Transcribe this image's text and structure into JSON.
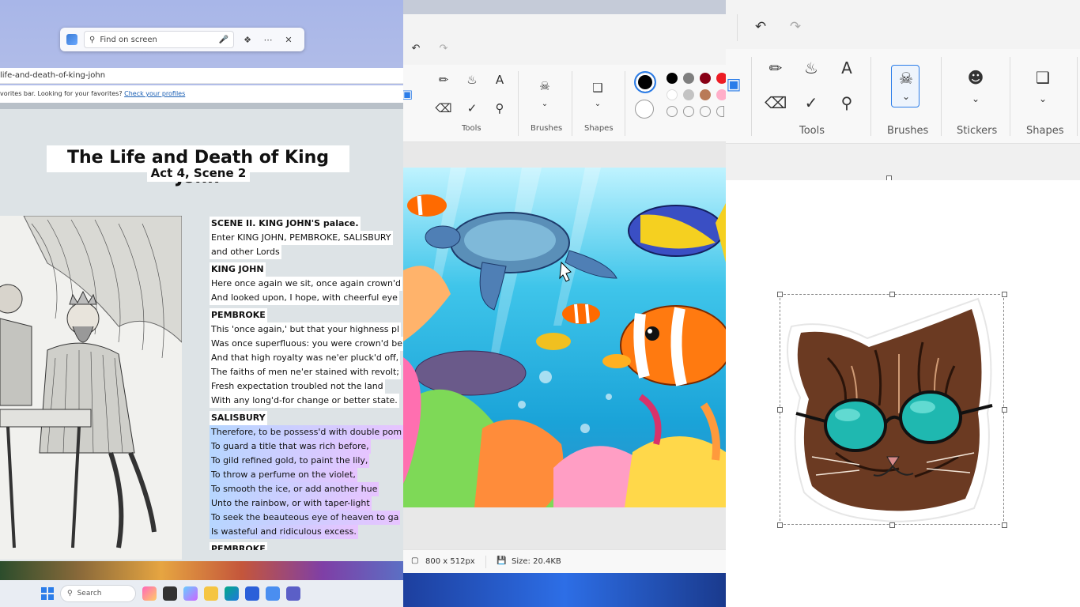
{
  "edge": {
    "find_placeholder": "Find on screen",
    "address": "life-and-death-of-king-john",
    "favorites_text": "vorites bar. Looking for your favorites?",
    "favorites_link": "Check your profiles",
    "title": "The Life and Death of King John",
    "subtitle": "Act 4, Scene 2",
    "scene_heading": "SCENE II. KING JOHN'S palace.",
    "stage_lines": [
      "Enter KING JOHN, PEMBROKE, SALISBURY",
      "and other Lords"
    ],
    "speech1": {
      "speaker": "KING JOHN",
      "lines": [
        "Here once again we sit, once again crown'd",
        "And looked upon, I hope, with cheerful eye"
      ]
    },
    "speech2": {
      "speaker": "PEMBROKE",
      "lines": [
        "This 'once again,' but that your highness pl",
        "Was once superfluous: you were crown'd be",
        "And that high royalty was ne'er pluck'd off,",
        "The faiths of men ne'er stained with revolt;",
        "Fresh expectation troubled not the land",
        "With any long'd-for change or better state."
      ]
    },
    "speech3": {
      "speaker": "SALISBURY",
      "lines": [
        "Therefore, to be possess'd with double pom",
        "To guard a title that was rich before,",
        "To gild refined gold, to paint the lily,",
        "To throw a perfume on the violet,",
        "To smooth the ice, or add another hue",
        "Unto the rainbow, or with taper-light",
        "To seek the beauteous eye of heaven to ga",
        "Is wasteful and ridiculous excess."
      ]
    },
    "next_speaker": "PEMBROKE",
    "taskbar_search": "Search"
  },
  "paint_small": {
    "group_tools": "Tools",
    "group_brushes": "Brushes",
    "group_shapes": "Shapes",
    "canvas_dims": "800  x  512px",
    "file_size": "Size: 20.4KB",
    "palette": [
      "#000000",
      "#7f7f7f",
      "#880015",
      "#ed1c24",
      "#ffffff",
      "#c3c3c3",
      "#b97a57",
      "#ffaec9"
    ]
  },
  "paint_large": {
    "group_tools": "Tools",
    "group_brushes": "Brushes",
    "group_stickers": "Stickers",
    "group_shapes": "Shapes"
  },
  "colors": {
    "accent": "#0067c0",
    "highlight_start": "#b6d6ff",
    "highlight_end": "#e7c4ff"
  }
}
